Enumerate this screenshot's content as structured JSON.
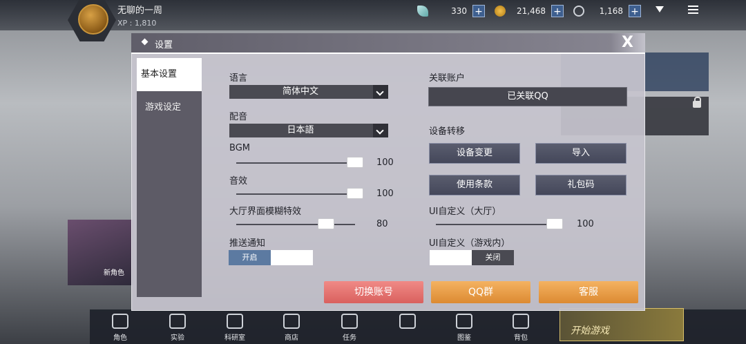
{
  "top": {
    "player_name": "无聊的一周",
    "xp": "XP : 1,810",
    "resources": [
      {
        "icon": "feather-gem-icon",
        "value": "330",
        "plus": "+"
      },
      {
        "icon": "gold-coin-icon",
        "value": "21,468",
        "plus": "+"
      },
      {
        "icon": "energy-icon",
        "value": "1,168",
        "plus": "+"
      }
    ]
  },
  "background": {
    "char_label": "新角色"
  },
  "bottom_nav": [
    {
      "label": "角色",
      "icon": "character-icon"
    },
    {
      "label": "实验",
      "icon": "experiment-icon"
    },
    {
      "label": "科研室",
      "icon": "lab-flask-icon"
    },
    {
      "label": "商店",
      "icon": "shop-cart-icon"
    },
    {
      "label": "任务",
      "icon": "mission-icon"
    },
    {
      "label": "",
      "icon": "lock-icon"
    },
    {
      "label": "图鉴",
      "icon": "codex-books-icon"
    },
    {
      "label": "背包",
      "icon": "backpack-icon"
    }
  ],
  "start_game": "开始游戏",
  "dialog": {
    "title": "设置",
    "close": "X",
    "tabs": [
      "基本设置",
      "游戏设定"
    ],
    "language": {
      "label": "语言",
      "value": "简体中文"
    },
    "voice": {
      "label": "配音",
      "value": "日本語"
    },
    "bgm": {
      "label": "BGM",
      "value": "100",
      "level": 1.0
    },
    "sfx": {
      "label": "音效",
      "value": "100",
      "level": 1.0
    },
    "blur": {
      "label": "大厅界面模糊特效",
      "value": "80",
      "level": 0.8
    },
    "push": {
      "label": "推送通知",
      "on": "开启",
      "state": "on"
    },
    "linked_account": {
      "label": "关联账户",
      "button": "已关联QQ"
    },
    "device_transfer": {
      "label": "设备转移",
      "buttons": [
        "设备变更",
        "导入",
        "使用条款",
        "礼包码"
      ]
    },
    "ui_lobby": {
      "label": "UI自定义（大厅）",
      "value": "100",
      "level": 1.0
    },
    "ui_ingame": {
      "label": "UI自定义（游戏内）",
      "off": "关闭",
      "state": "off"
    },
    "footer": [
      "切换账号",
      "QQ群",
      "客服"
    ]
  },
  "colors": {
    "accent_red": "#d9605e",
    "accent_orange": "#dc8a32",
    "toggle_active": "#5c7aa1"
  }
}
